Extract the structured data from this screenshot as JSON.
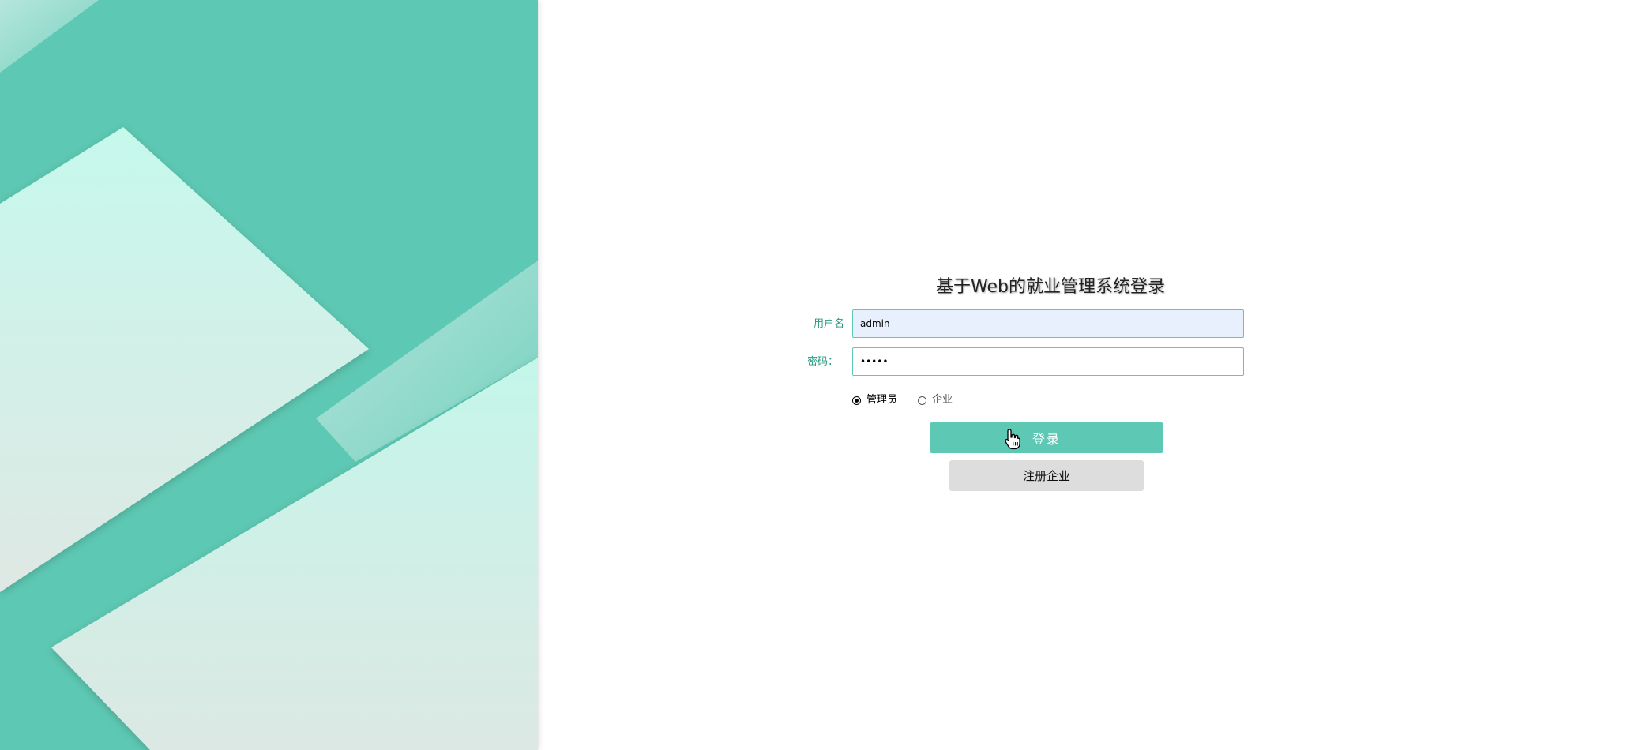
{
  "login": {
    "title": "基于Web的就业管理系统登录",
    "username_label": "用户名",
    "username_value": "admin",
    "password_label": "密码：",
    "password_value": "•••••",
    "roles": [
      {
        "label": "管理员",
        "checked": true
      },
      {
        "label": "企业",
        "checked": false
      }
    ],
    "login_button": "登录",
    "register_button": "注册企业"
  },
  "theme": {
    "accent": "#5dc8b3",
    "accent_text": "#2a9a80",
    "secondary_button": "#dddddd"
  },
  "icons": {
    "cursor": "hand-pointer-icon"
  }
}
